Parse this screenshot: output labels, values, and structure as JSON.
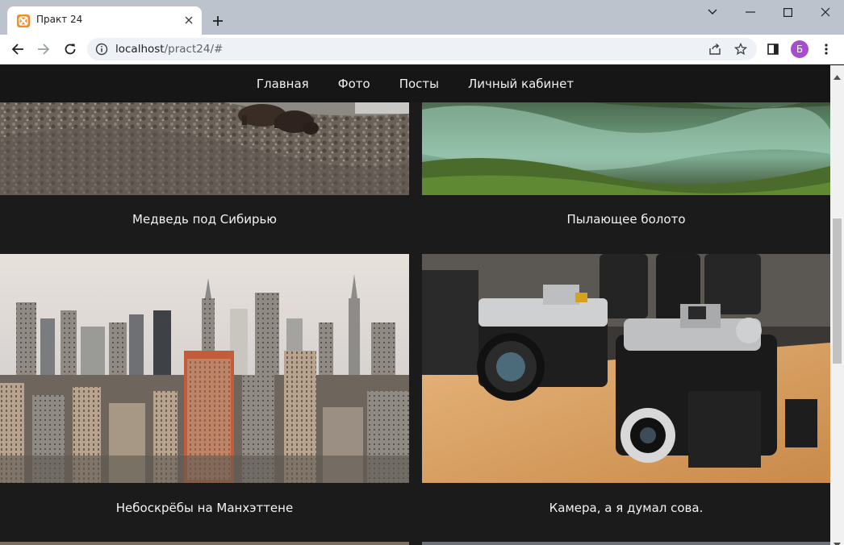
{
  "browser": {
    "tab_title": "Практ 24",
    "url_host": "localhost",
    "url_path": "/pract24/#",
    "profile_initial": "Б",
    "accent_color": "#a84bd0"
  },
  "site": {
    "nav": [
      "Главная",
      "Фото",
      "Посты",
      "Личный кабинет"
    ]
  },
  "gallery": {
    "items": [
      {
        "caption": "Медведь под Сибирью",
        "image": "bear-on-rocky-hill-photo"
      },
      {
        "caption": "Пылающее болото",
        "image": "steaming-swamp-photo"
      },
      {
        "caption": "Небоскрёбы на Манхэттене",
        "image": "manhattan-skyline-photo"
      },
      {
        "caption": "Камера, а я думал сова.",
        "image": "vintage-cameras-photo"
      }
    ]
  }
}
